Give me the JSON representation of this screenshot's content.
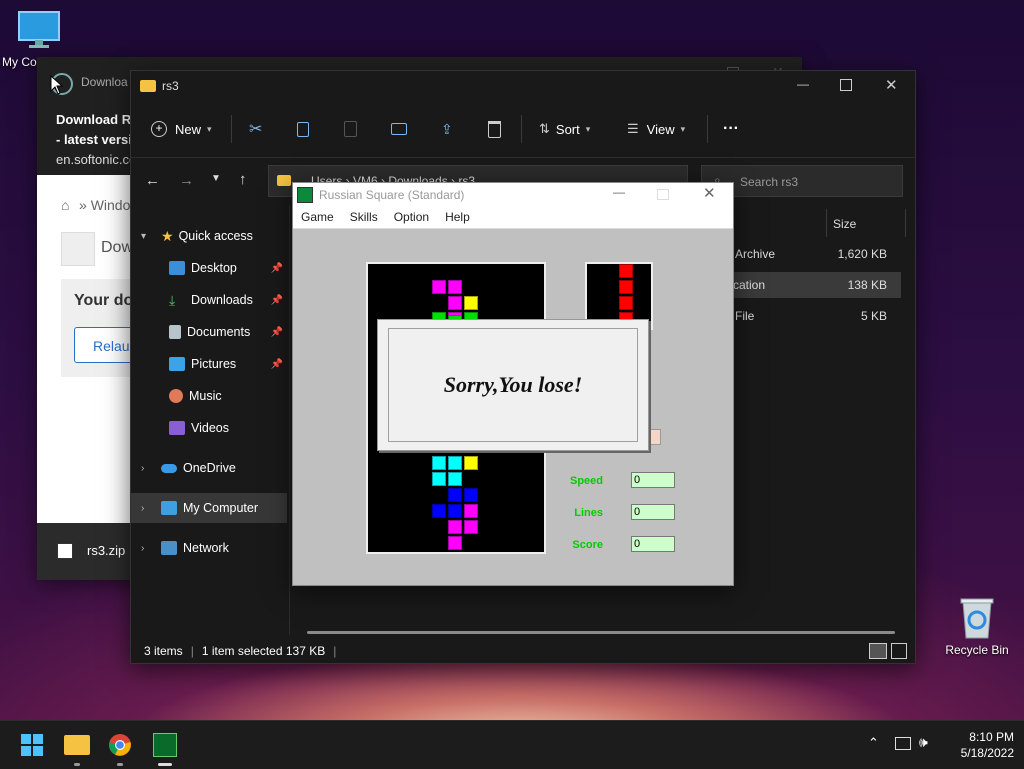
{
  "desktop": {
    "my_computer_label": "My Co",
    "recycle_bin_label": "Recycle Bin"
  },
  "browser": {
    "tab_title": "Downloa",
    "notif_line1": "Download R",
    "notif_line2": "- latest versi",
    "notif_line3": "en.softonic.co",
    "breadcrumb": "Windo",
    "heading_partial": "Dow",
    "your_download": "Your do",
    "relaunch": "Relau",
    "download_file": "rs3.zip"
  },
  "explorer": {
    "title": "rs3",
    "toolbar": {
      "new_label": "New",
      "sort_label": "Sort",
      "view_label": "View",
      "more_label": "···"
    },
    "address_path": "Users  ›  VM6  ›  Downloads  ›  rs3",
    "search_placeholder": "Search rs3",
    "columns": {
      "type_partial": "e",
      "size": "Size"
    },
    "files": [
      {
        "type": "Archive",
        "size": "1,620 KB"
      },
      {
        "type": "plication",
        "size": "138 KB"
      },
      {
        "type": "File",
        "size": "5 KB"
      }
    ],
    "sidebar": {
      "quick_access": "Quick access",
      "items": [
        "Desktop",
        "Downloads",
        "Documents",
        "Pictures",
        "Music",
        "Videos"
      ],
      "onedrive": "OneDrive",
      "my_computer": "My Computer",
      "network": "Network"
    },
    "status": {
      "items": "3 items",
      "selected": "1 item selected  137 KB"
    }
  },
  "game": {
    "title": "Russian Square (Standard)",
    "menu": [
      "Game",
      "Skills",
      "Option",
      "Help"
    ],
    "dialog_text": "Sorry,You lose!",
    "stats": [
      {
        "label": "Speed",
        "value": "0"
      },
      {
        "label": "Lines",
        "value": "0"
      },
      {
        "label": "Score",
        "value": "0"
      }
    ],
    "colors": {
      "magenta": "#ff00ff",
      "green": "#00dd00",
      "cyan": "#00ffff",
      "yellow": "#ffff00",
      "blue": "#0000ff",
      "red": "#ff0000"
    }
  },
  "taskbar": {
    "time": "8:10 PM",
    "date": "5/18/2022"
  }
}
